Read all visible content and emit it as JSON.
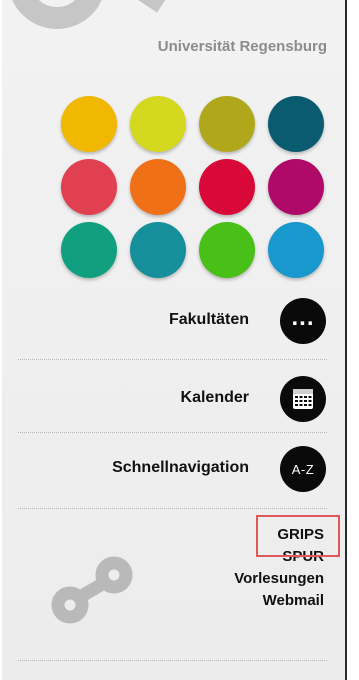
{
  "header": {
    "university": "Universität Regensburg"
  },
  "faculty_dots": [
    {
      "color": "#f0b800"
    },
    {
      "color": "#d4d81e"
    },
    {
      "color": "#b0a81a"
    },
    {
      "color": "#0a5a70"
    },
    {
      "color": "#e04050"
    },
    {
      "color": "#f07018"
    },
    {
      "color": "#d80838"
    },
    {
      "color": "#b00a68"
    },
    {
      "color": "#10a080"
    },
    {
      "color": "#15909a"
    },
    {
      "color": "#48c018"
    },
    {
      "color": "#1898cc"
    }
  ],
  "nav": {
    "fakultaeten": {
      "label": "Fakultäten",
      "icon": "ellipsis-icon",
      "glyph": "..."
    },
    "kalender": {
      "label": "Kalender",
      "icon": "calendar-icon"
    },
    "schnellnavigation": {
      "label": "Schnellnavigation",
      "icon": "a-z-icon",
      "glyph": "A-Z"
    }
  },
  "links": [
    "GRIPS",
    "SPUR",
    "Vorlesungen",
    "Webmail"
  ],
  "colors": {
    "highlight": "#e0585a",
    "icon_bg": "#0a0a0a"
  }
}
